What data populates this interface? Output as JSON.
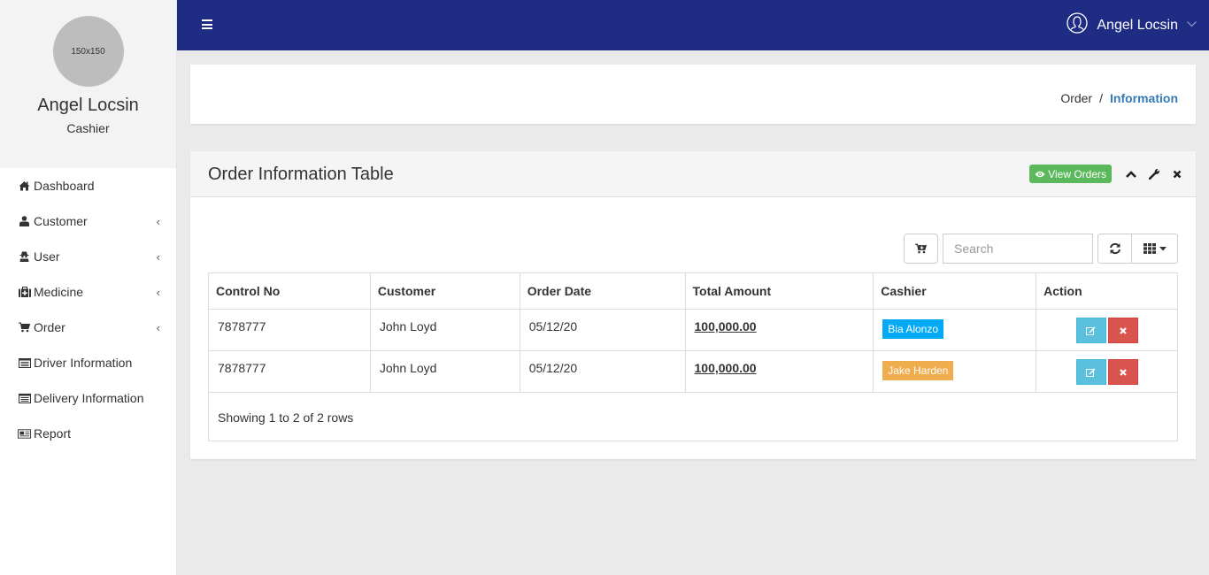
{
  "sidebar": {
    "avatar_text": "150x150",
    "user_name": "Angel Locsin",
    "user_role": "Cashier",
    "items": [
      {
        "label": "Dashboard",
        "icon": "home-icon",
        "has_submenu": false
      },
      {
        "label": "Customer",
        "icon": "user-icon",
        "has_submenu": true
      },
      {
        "label": "User",
        "icon": "user-secret-icon",
        "has_submenu": true
      },
      {
        "label": "Medicine",
        "icon": "medkit-icon",
        "has_submenu": true
      },
      {
        "label": "Order",
        "icon": "cart-icon",
        "has_submenu": true
      },
      {
        "label": "Driver Information",
        "icon": "list-alt-icon",
        "has_submenu": false
      },
      {
        "label": "Delivery Information",
        "icon": "list-alt-icon",
        "has_submenu": false
      },
      {
        "label": "Report",
        "icon": "newspaper-icon",
        "has_submenu": false
      }
    ],
    "chevron": "‹"
  },
  "topbar": {
    "user_name": "Angel Locsin"
  },
  "breadcrumb": {
    "parent": "Order",
    "separator": "/",
    "current": "Information"
  },
  "panel": {
    "title": "Order Information Table",
    "view_orders_label": "View Orders",
    "search_placeholder": "Search"
  },
  "table": {
    "headers": [
      "Control No",
      "Customer",
      "Order Date",
      "Total Amount",
      "Cashier",
      "Action"
    ],
    "rows": [
      {
        "control_no": "7878777",
        "customer": "John Loyd",
        "order_date": "05/12/20",
        "total_amount": "100,000.00",
        "cashier": "Bia Alonzo",
        "cashier_color": "#03a9f4"
      },
      {
        "control_no": "7878777",
        "customer": "John Loyd",
        "order_date": "05/12/20",
        "total_amount": "100,000.00",
        "cashier": "Jake Harden",
        "cashier_color": "#f0ad4e"
      }
    ],
    "footer": "Showing 1 to 2 of 2 rows"
  },
  "colors": {
    "topbar": "#1f2c84",
    "breadcrumb_active": "#337ab7",
    "view_orders": "#5cb85c",
    "edit_button": "#5bc0de",
    "delete_button": "#d9534f"
  }
}
